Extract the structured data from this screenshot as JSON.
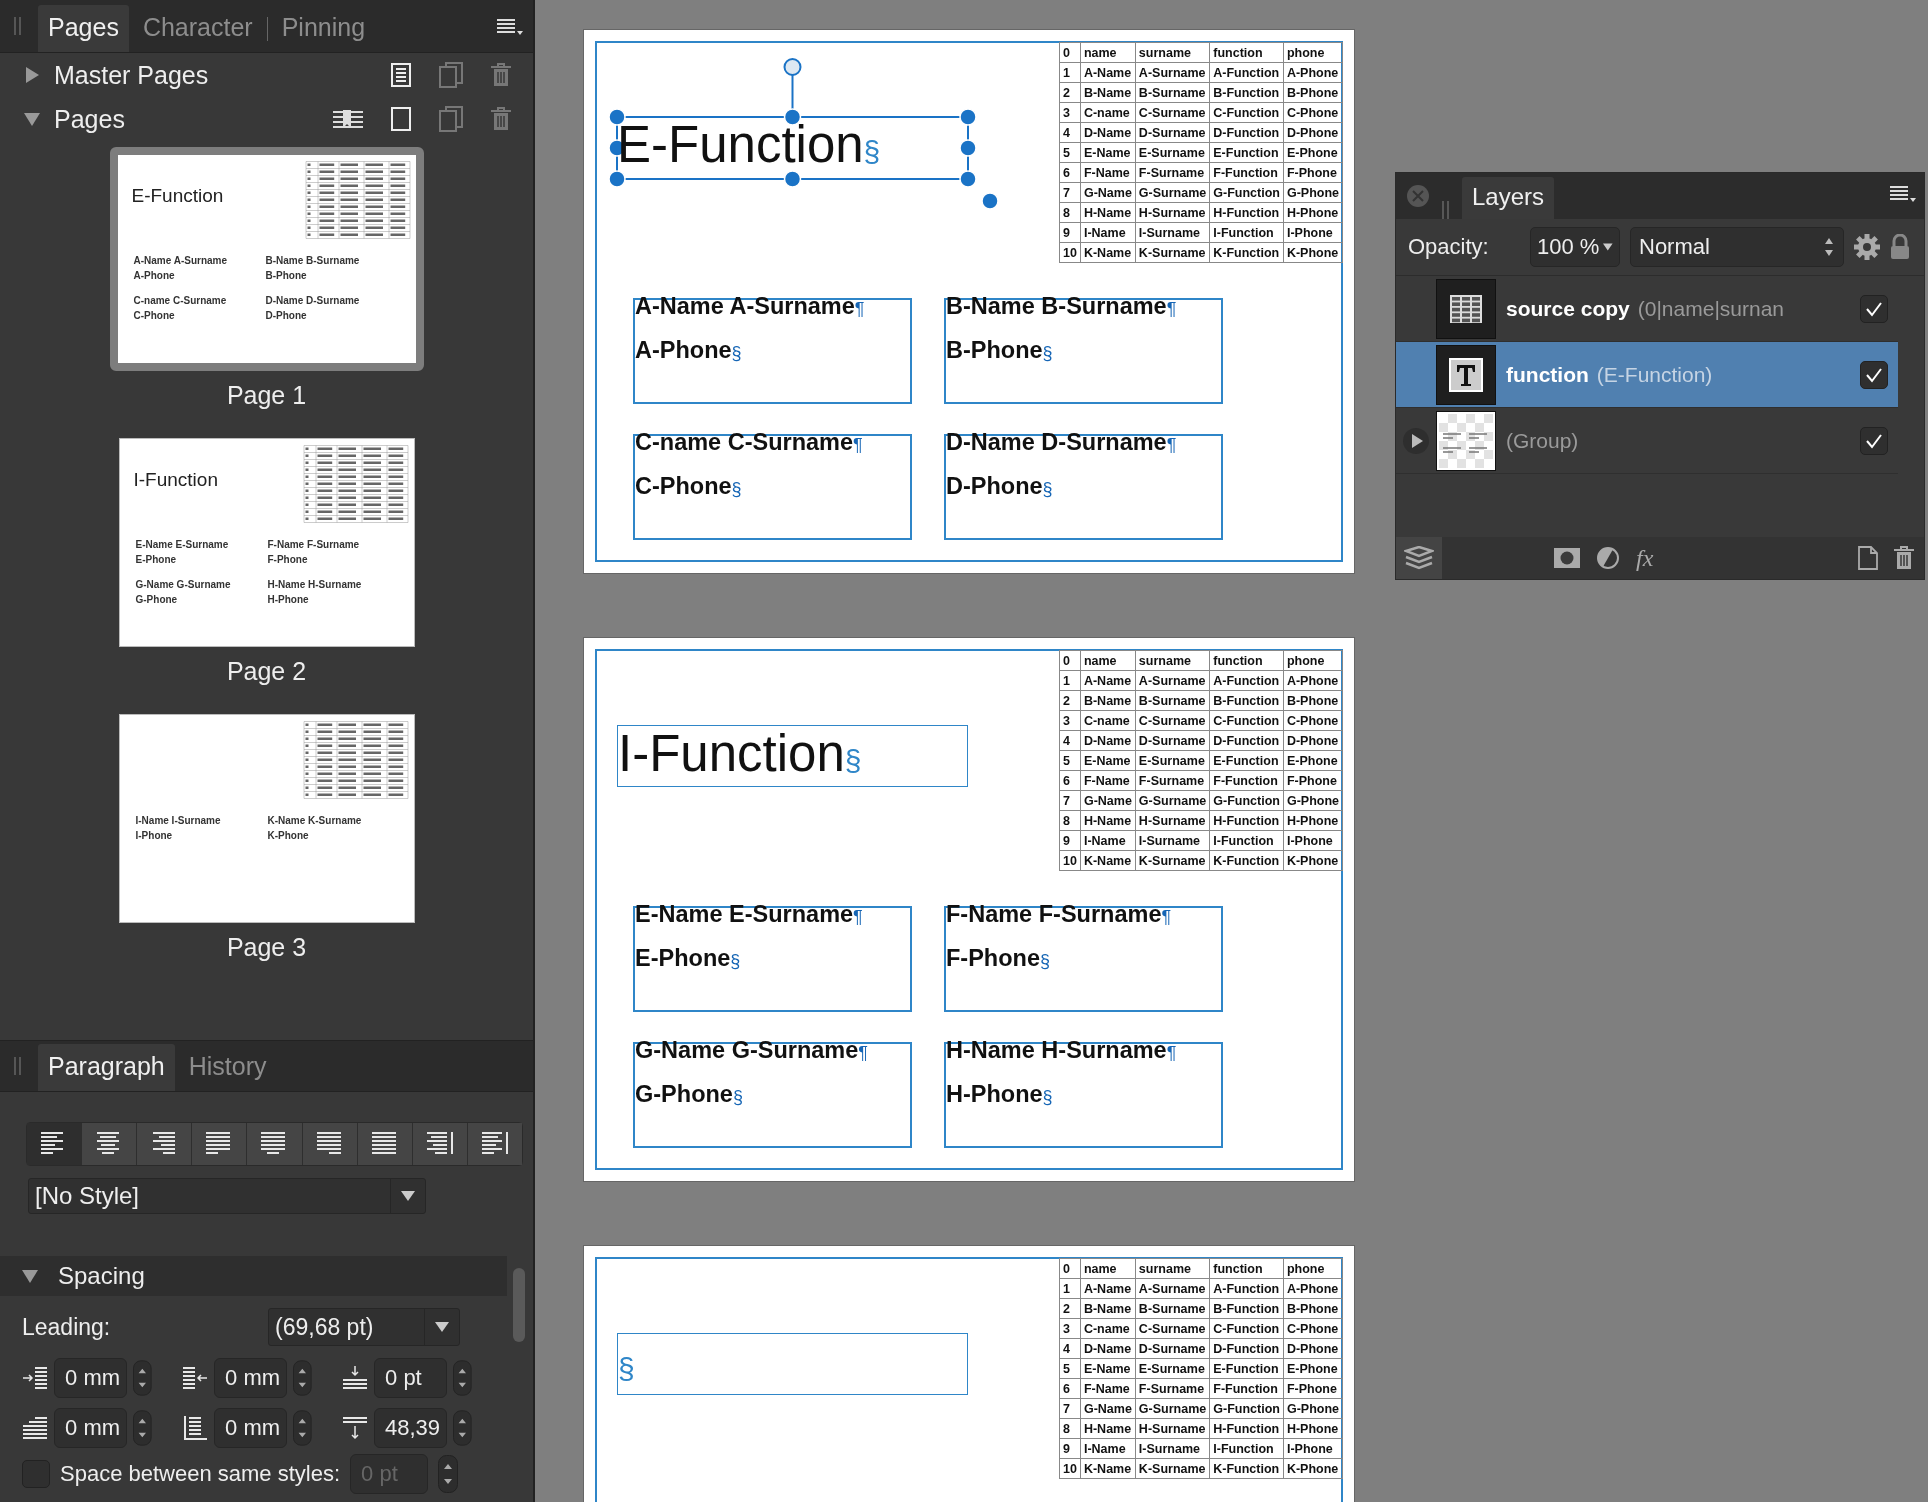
{
  "pages_panel": {
    "tabs": [
      {
        "label": "Pages",
        "selected": true
      },
      {
        "label": "Character",
        "selected": false
      },
      {
        "label": "Pinning",
        "selected": false
      }
    ],
    "sections": [
      {
        "kind": "master",
        "label": "Master Pages",
        "expanded": false
      },
      {
        "kind": "pages",
        "label": "Pages",
        "expanded": true
      }
    ],
    "thumbnails": [
      {
        "label": "Page 1",
        "selected": true,
        "title": "E-Function",
        "cards": [
          {
            "line1": "A-Name A-Surname",
            "line2": "A-Phone"
          },
          {
            "line1": "B-Name B-Surname",
            "line2": "B-Phone"
          },
          {
            "line1": "C-name C-Surname",
            "line2": "C-Phone"
          },
          {
            "line1": "D-Name D-Surname",
            "line2": "D-Phone"
          }
        ]
      },
      {
        "label": "Page 2",
        "selected": false,
        "title": "I-Function",
        "cards": [
          {
            "line1": "E-Name E-Surname",
            "line2": "E-Phone"
          },
          {
            "line1": "F-Name F-Surname",
            "line2": "F-Phone"
          },
          {
            "line1": "G-Name G-Surname",
            "line2": "G-Phone"
          },
          {
            "line1": "H-Name H-Surname",
            "line2": "H-Phone"
          }
        ]
      },
      {
        "label": "Page 3",
        "selected": false,
        "cards": [
          {
            "line1": "I-Name I-Surname",
            "line2": "I-Phone"
          },
          {
            "line1": "K-Name K-Surname",
            "line2": "K-Phone"
          }
        ]
      }
    ]
  },
  "paragraph_panel": {
    "tabs": [
      {
        "label": "Paragraph",
        "selected": true
      },
      {
        "label": "History",
        "selected": false
      }
    ],
    "alignments": [
      {
        "kind": "left",
        "selected": true
      },
      {
        "kind": "center",
        "selected": false
      },
      {
        "kind": "right",
        "selected": false
      },
      {
        "kind": "justify-left",
        "selected": false
      },
      {
        "kind": "justify-center",
        "selected": false
      },
      {
        "kind": "justify-right",
        "selected": false
      },
      {
        "kind": "justify-all",
        "selected": false
      },
      {
        "kind": "toward-spine",
        "selected": false
      },
      {
        "kind": "away-from-spine",
        "selected": false
      }
    ],
    "style": "[No Style]",
    "spacing": {
      "label": "Spacing",
      "expanded": true,
      "leading_label": "Leading:",
      "leading": "(69,68 pt)",
      "fields": [
        {
          "kind": "left-indent",
          "value": "0 mm"
        },
        {
          "kind": "right-indent",
          "value": "0 mm"
        },
        {
          "kind": "space-before",
          "value": "0 pt"
        },
        {
          "kind": "first-line-indent",
          "value": "0 mm"
        },
        {
          "kind": "last-line-indent",
          "value": "0 mm"
        },
        {
          "kind": "space-after",
          "value": "48,39"
        }
      ],
      "same_styles": {
        "label": "Space between same styles:",
        "checked": false,
        "value": "0 pt",
        "disabled": true
      }
    }
  },
  "document": {
    "pages": [
      {
        "title": "E-Function",
        "title_mark": "§",
        "selected": true,
        "table": [
          [
            "0",
            "name",
            "surname",
            "function",
            "phone"
          ],
          [
            "1",
            "A-Name",
            "A-Surname",
            "A-Function",
            "A-Phone"
          ],
          [
            "2",
            "B-Name",
            "B-Surname",
            "B-Function",
            "B-Phone"
          ],
          [
            "3",
            "C-name",
            "C-Surname",
            "C-Function",
            "C-Phone"
          ],
          [
            "4",
            "D-Name",
            "D-Surname",
            "D-Function",
            "D-Phone"
          ],
          [
            "5",
            "E-Name",
            "E-Surname",
            "E-Function",
            "E-Phone"
          ],
          [
            "6",
            "F-Name",
            "F-Surname",
            "F-Function",
            "F-Phone"
          ],
          [
            "7",
            "G-Name",
            "G-Surname",
            "G-Function",
            "G-Phone"
          ],
          [
            "8",
            "H-Name",
            "H-Surname",
            "H-Function",
            "H-Phone"
          ],
          [
            "9",
            "I-Name",
            "I-Surname",
            "I-Function",
            "I-Phone"
          ],
          [
            "10",
            "K-Name",
            "K-Surname",
            "K-Function",
            "K-Phone"
          ]
        ],
        "cards": [
          {
            "line1": "A-Name A-Surname",
            "mark1": "¶",
            "line2": "A-Phone",
            "mark2": "§"
          },
          {
            "line1": "B-Name B-Surname",
            "mark1": "¶",
            "line2": "B-Phone",
            "mark2": "§"
          },
          {
            "line1": "C-name C-Surname",
            "mark1": "¶",
            "line2": "C-Phone",
            "mark2": "§"
          },
          {
            "line1": "D-Name D-Surname",
            "mark1": "¶",
            "line2": "D-Phone",
            "mark2": "§"
          }
        ]
      },
      {
        "title": "I-Function",
        "title_mark": "§",
        "selected": false,
        "table": [
          [
            "0",
            "name",
            "surname",
            "function",
            "phone"
          ],
          [
            "1",
            "A-Name",
            "A-Surname",
            "A-Function",
            "A-Phone"
          ],
          [
            "2",
            "B-Name",
            "B-Surname",
            "B-Function",
            "B-Phone"
          ],
          [
            "3",
            "C-name",
            "C-Surname",
            "C-Function",
            "C-Phone"
          ],
          [
            "4",
            "D-Name",
            "D-Surname",
            "D-Function",
            "D-Phone"
          ],
          [
            "5",
            "E-Name",
            "E-Surname",
            "E-Function",
            "E-Phone"
          ],
          [
            "6",
            "F-Name",
            "F-Surname",
            "F-Function",
            "F-Phone"
          ],
          [
            "7",
            "G-Name",
            "G-Surname",
            "G-Function",
            "G-Phone"
          ],
          [
            "8",
            "H-Name",
            "H-Surname",
            "H-Function",
            "H-Phone"
          ],
          [
            "9",
            "I-Name",
            "I-Surname",
            "I-Function",
            "I-Phone"
          ],
          [
            "10",
            "K-Name",
            "K-Surname",
            "K-Function",
            "K-Phone"
          ]
        ],
        "cards": [
          {
            "line1": "E-Name E-Surname",
            "mark1": "¶",
            "line2": "E-Phone",
            "mark2": "§"
          },
          {
            "line1": "F-Name F-Surname",
            "mark1": "¶",
            "line2": "F-Phone",
            "mark2": "§"
          },
          {
            "line1": "G-Name G-Surname",
            "mark1": "¶",
            "line2": "G-Phone",
            "mark2": "§"
          },
          {
            "line1": "H-Name H-Surname",
            "mark1": "¶",
            "line2": "H-Phone",
            "mark2": "§"
          }
        ]
      },
      {
        "title_mark": "§",
        "selected": false,
        "table": [
          [
            "0",
            "name",
            "surname",
            "function",
            "phone"
          ],
          [
            "1",
            "A-Name",
            "A-Surname",
            "A-Function",
            "A-Phone"
          ],
          [
            "2",
            "B-Name",
            "B-Surname",
            "B-Function",
            "B-Phone"
          ],
          [
            "3",
            "C-name",
            "C-Surname",
            "C-Function",
            "C-Phone"
          ],
          [
            "4",
            "D-Name",
            "D-Surname",
            "D-Function",
            "D-Phone"
          ],
          [
            "5",
            "E-Name",
            "E-Surname",
            "E-Function",
            "E-Phone"
          ],
          [
            "6",
            "F-Name",
            "F-Surname",
            "F-Function",
            "F-Phone"
          ],
          [
            "7",
            "G-Name",
            "G-Surname",
            "G-Function",
            "G-Phone"
          ],
          [
            "8",
            "H-Name",
            "H-Surname",
            "H-Function",
            "H-Phone"
          ],
          [
            "9",
            "I-Name",
            "I-Surname",
            "I-Function",
            "I-Phone"
          ],
          [
            "10",
            "K-Name",
            "K-Surname",
            "K-Function",
            "K-Phone"
          ]
        ]
      }
    ]
  },
  "layers_panel": {
    "title": "Layers",
    "opacity_label": "Opacity:",
    "opacity": "100 %",
    "blend_mode": "Normal",
    "layers": [
      {
        "kind": "table",
        "name": "source copy",
        "detail": "(0|name|surnan",
        "selected": false,
        "visible": true
      },
      {
        "kind": "text",
        "name": "function",
        "detail": "(E-Function)",
        "selected": true,
        "visible": true
      },
      {
        "kind": "group",
        "detail": "(Group)",
        "selected": false,
        "visible": true,
        "expanded": false
      }
    ],
    "tools": [
      {
        "kind": "layers"
      },
      {
        "kind": "mask"
      },
      {
        "kind": "adjustment"
      },
      {
        "kind": "fx",
        "label": "fx"
      },
      {
        "kind": "new"
      },
      {
        "kind": "trash"
      }
    ]
  }
}
